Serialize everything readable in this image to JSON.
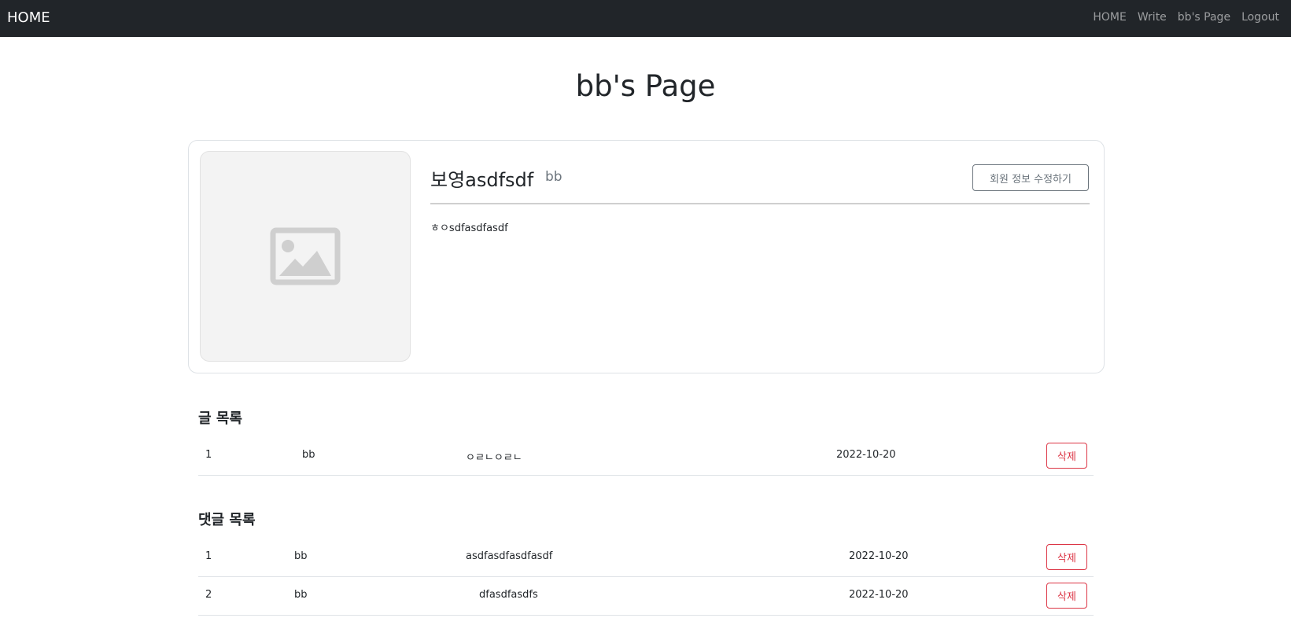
{
  "navbar": {
    "brand": "HOME",
    "links": [
      {
        "label": "HOME"
      },
      {
        "label": "Write"
      },
      {
        "label": "bb's Page"
      },
      {
        "label": "Logout"
      }
    ]
  },
  "page": {
    "title": "bb's Page"
  },
  "profile": {
    "name": "보영asdfsdf",
    "username": "bb",
    "edit_button_label": "회원 정보 수정하기",
    "bio": "ㅎㅇsdfasdfasdf",
    "avatar_icon": "image-placeholder-icon"
  },
  "posts": {
    "title": "글 목록",
    "rows": [
      {
        "no": "1",
        "author": "bb",
        "content": "ㅇㄹㄴㅇㄹㄴ",
        "date": "2022-10-20",
        "delete_label": "삭제"
      }
    ]
  },
  "comments": {
    "title": "댓글 목록",
    "rows": [
      {
        "no": "1",
        "author": "bb",
        "content": "asdfasdfasdfasdf",
        "date": "2022-10-20",
        "delete_label": "삭제"
      },
      {
        "no": "2",
        "author": "bb",
        "content": "dfasdfasdfs",
        "date": "2022-10-20",
        "delete_label": "삭제"
      }
    ]
  },
  "colors": {
    "navbar_bg": "#212529",
    "danger": "#dc3545",
    "secondary": "#6c757d"
  }
}
